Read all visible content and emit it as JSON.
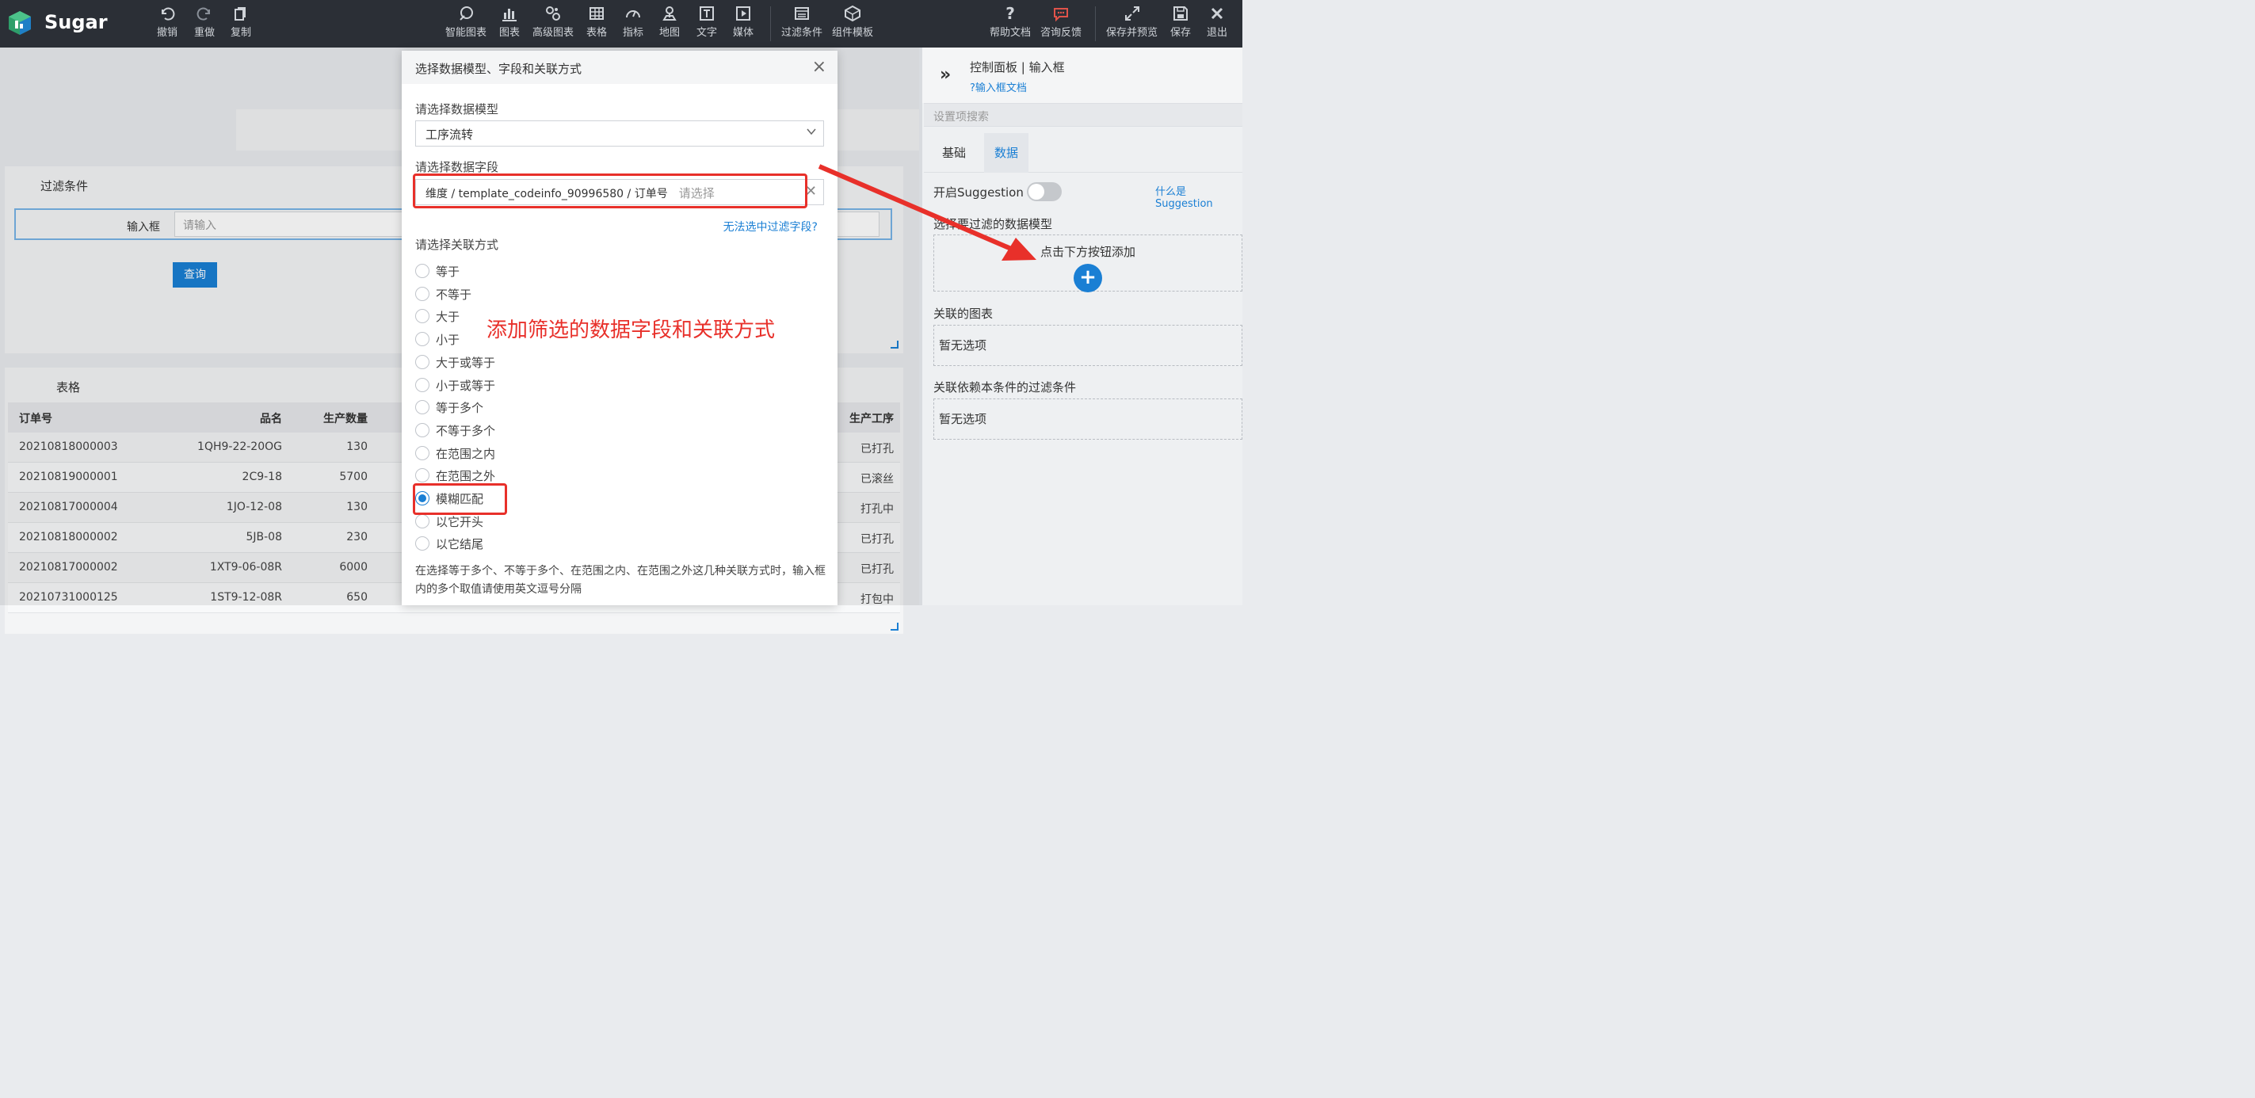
{
  "app": {
    "name": "Sugar"
  },
  "toolbar": {
    "left": [
      {
        "label": "撤销",
        "icon": "undo-icon"
      },
      {
        "label": "重做",
        "icon": "redo-icon"
      },
      {
        "label": "复制",
        "icon": "copy-icon"
      }
    ],
    "center": [
      {
        "label": "智能图表",
        "icon": "smart-chart-icon"
      },
      {
        "label": "图表",
        "icon": "bar-chart-icon"
      },
      {
        "label": "高级图表",
        "icon": "advanced-chart-icon"
      },
      {
        "label": "表格",
        "icon": "table-icon"
      },
      {
        "label": "指标",
        "icon": "gauge-icon"
      },
      {
        "label": "地图",
        "icon": "map-pin-icon"
      },
      {
        "label": "文字",
        "icon": "text-icon"
      },
      {
        "label": "媒体",
        "icon": "media-icon"
      },
      {
        "label": "过滤条件",
        "icon": "filter-icon"
      },
      {
        "label": "组件模板",
        "icon": "template-icon"
      }
    ],
    "right": [
      {
        "label": "帮助文档",
        "icon": "help-icon"
      },
      {
        "label": "咨询反馈",
        "icon": "chat-icon"
      },
      {
        "label": "保存并预览",
        "icon": "expand-icon"
      },
      {
        "label": "保存",
        "icon": "save-icon"
      },
      {
        "label": "退出",
        "icon": "close-icon"
      }
    ]
  },
  "filter_panel": {
    "title": "过滤条件",
    "input_label": "输入框",
    "input_placeholder": "请输入",
    "query_label": "查询"
  },
  "table_panel": {
    "title": "表格",
    "columns": [
      "订单号",
      "品名",
      "生产数量",
      "生产工序"
    ],
    "rows": [
      [
        "20210818000003",
        "1QH9-22-20OG",
        "130",
        "已打孔"
      ],
      [
        "20210819000001",
        "2C9-18",
        "5700",
        "已滚丝"
      ],
      [
        "20210817000004",
        "1JO-12-08",
        "130",
        "打孔中"
      ],
      [
        "20210818000002",
        "5JB-08",
        "230",
        "已打孔"
      ],
      [
        "20210817000002",
        "1XT9-06-08R",
        "6000",
        "已打孔"
      ],
      [
        "20210731000125",
        "1ST9-12-08R",
        "650",
        "打包中"
      ]
    ]
  },
  "right_panel": {
    "title": "控制面板 | 输入框",
    "doc_link": "?输入框文档",
    "search_placeholder": "设置项搜索",
    "tabs": [
      "基础",
      "数据"
    ],
    "active_tab": "数据",
    "suggestion_label": "开启Suggestion",
    "suggestion_on": false,
    "suggestion_link": "什么是Suggestion",
    "model_section_label": "选择要过滤的数据模型",
    "add_hint": "点击下方按钮添加",
    "linked_charts_label": "关联的图表",
    "linked_charts_empty": "暂无选项",
    "dependent_filters_label": "关联依赖本条件的过滤条件",
    "dependent_filters_empty": "暂无选项"
  },
  "modal": {
    "title": "选择数据模型、字段和关联方式",
    "model_label": "请选择数据模型",
    "model_value": "工序流转",
    "field_label": "请选择数据字段",
    "field_value": "维度 / template_codeinfo_90996580 / 订单号",
    "field_placeholder": "请选择",
    "cant_select_link": "无法选中过滤字段?",
    "relation_label": "请选择关联方式",
    "relations": [
      "等于",
      "不等于",
      "大于",
      "小于",
      "大于或等于",
      "小于或等于",
      "等于多个",
      "不等于多个",
      "在范围之内",
      "在范围之外",
      "模糊匹配",
      "以它开头",
      "以它结尾"
    ],
    "selected_relation": "模糊匹配",
    "note": "在选择等于多个、不等于多个、在范围之内、在范围之外这几种关联方式时，输入框内的多个取值请使用英文逗号分隔"
  },
  "annotation": {
    "text": "添加筛选的数据字段和关联方式",
    "color": "#e8302a"
  }
}
